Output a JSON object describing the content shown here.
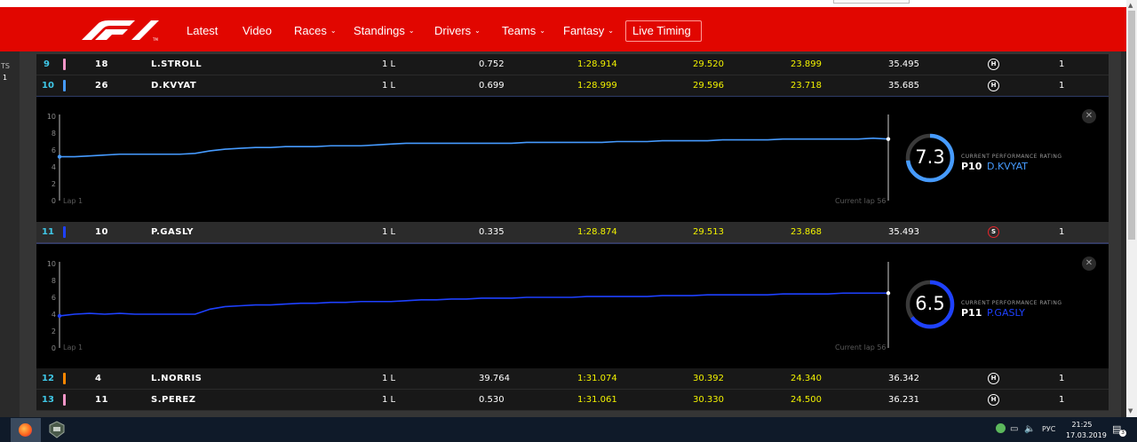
{
  "nav": {
    "items": [
      "Latest",
      "Video",
      "Races",
      "Standings",
      "Drivers",
      "Teams",
      "Fantasy",
      "Live Timing"
    ]
  },
  "left_panel": {
    "top_text": "TS",
    "count": "1"
  },
  "rows": [
    {
      "pos": "9",
      "num": "18",
      "name": "L.STROLL",
      "laps": "1 L",
      "gap": "0.752",
      "best": "1:28.914",
      "s1": "29.520",
      "s2": "23.899",
      "s3": "35.495",
      "tyre": "H",
      "stops": "1",
      "bar_color": "#f596c8"
    },
    {
      "pos": "10",
      "num": "26",
      "name": "D.KVYAT",
      "laps": "1 L",
      "gap": "0.699",
      "best": "1:28.999",
      "s1": "29.596",
      "s2": "23.718",
      "s3": "35.685",
      "tyre": "H",
      "stops": "1",
      "bar_color": "#469bff"
    },
    {
      "pos": "11",
      "num": "10",
      "name": "P.GASLY",
      "laps": "1 L",
      "gap": "0.335",
      "best": "1:28.874",
      "s1": "29.513",
      "s2": "23.868",
      "s3": "35.493",
      "tyre": "S",
      "stops": "1",
      "bar_color": "#1e41ff"
    },
    {
      "pos": "12",
      "num": "4",
      "name": "L.NORRIS",
      "laps": "1 L",
      "gap": "39.764",
      "best": "1:31.074",
      "s1": "30.392",
      "s2": "24.340",
      "s3": "36.342",
      "tyre": "H",
      "stops": "1",
      "bar_color": "#ff8700"
    },
    {
      "pos": "13",
      "num": "11",
      "name": "S.PEREZ",
      "laps": "1 L",
      "gap": "0.530",
      "best": "1:31.061",
      "s1": "30.330",
      "s2": "24.500",
      "s3": "36.231",
      "tyre": "H",
      "stops": "1",
      "bar_color": "#f596c8"
    }
  ],
  "panels": [
    {
      "rating": "7.3",
      "rating_label": "CURRENT PERFORMANCE RATING",
      "position": "P10",
      "driver": "D.KVYAT",
      "color": "#469bff",
      "fraction": 0.73,
      "lap_start_label": "Lap 1",
      "lap_current_label": "Current lap 56",
      "y_ticks": [
        "10",
        "8",
        "6",
        "4",
        "2",
        "0"
      ],
      "series": [
        5.2,
        5.2,
        5.3,
        5.4,
        5.5,
        5.5,
        5.5,
        5.5,
        5.5,
        5.6,
        5.9,
        6.1,
        6.2,
        6.3,
        6.3,
        6.4,
        6.4,
        6.4,
        6.5,
        6.5,
        6.5,
        6.6,
        6.7,
        6.8,
        6.8,
        6.8,
        6.8,
        6.8,
        6.8,
        6.8,
        6.8,
        6.9,
        6.9,
        6.9,
        6.9,
        6.9,
        6.9,
        7.0,
        7.0,
        7.0,
        7.1,
        7.1,
        7.1,
        7.1,
        7.2,
        7.2,
        7.2,
        7.2,
        7.3,
        7.3,
        7.3,
        7.3,
        7.3,
        7.3,
        7.4,
        7.3
      ]
    },
    {
      "rating": "6.5",
      "rating_label": "CURRENT PERFORMANCE RATING",
      "position": "P11",
      "driver": "P.GASLY",
      "color": "#1e41ff",
      "fraction": 0.65,
      "lap_start_label": "Lap 1",
      "lap_current_label": "Current lap 56",
      "y_ticks": [
        "10",
        "8",
        "6",
        "4",
        "2",
        "0"
      ],
      "series": [
        3.8,
        4.0,
        4.1,
        4.0,
        4.1,
        4.0,
        4.0,
        4.0,
        4.0,
        4.0,
        4.6,
        4.9,
        5.0,
        5.1,
        5.1,
        5.2,
        5.3,
        5.3,
        5.4,
        5.4,
        5.5,
        5.5,
        5.5,
        5.6,
        5.7,
        5.7,
        5.8,
        5.8,
        5.9,
        5.9,
        5.9,
        6.0,
        6.0,
        6.0,
        6.0,
        6.1,
        6.1,
        6.1,
        6.1,
        6.1,
        6.2,
        6.2,
        6.2,
        6.3,
        6.3,
        6.3,
        6.3,
        6.3,
        6.4,
        6.4,
        6.4,
        6.4,
        6.5,
        6.5,
        6.5,
        6.5
      ]
    }
  ],
  "taskbar": {
    "lang": "РУС",
    "time": "21:25",
    "date": "17.03.2019",
    "notifications": "3"
  }
}
